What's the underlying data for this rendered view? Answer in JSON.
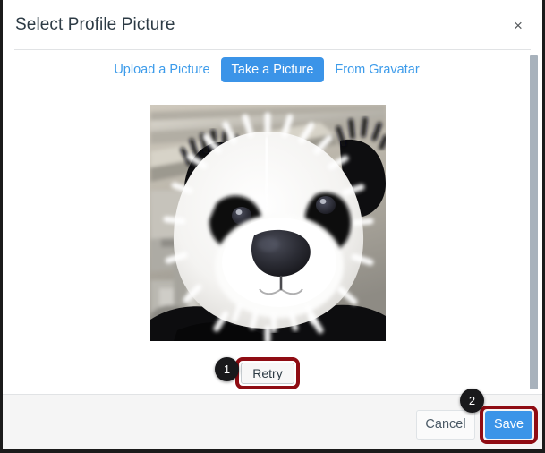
{
  "dialog": {
    "title": "Select Profile Picture",
    "close_icon": "close-icon",
    "close_label": "×"
  },
  "tabs": [
    {
      "label": "Upload a Picture",
      "selected": false
    },
    {
      "label": "Take a Picture",
      "selected": true
    },
    {
      "label": "From Gravatar",
      "selected": false
    }
  ],
  "preview": {
    "alt": "panda-mascot-photo",
    "description": "Close-up photo of a black and white panda mascot costume head indoors"
  },
  "actions": {
    "retry_label": "Retry",
    "cancel_label": "Cancel",
    "save_label": "Save"
  },
  "annotations": {
    "badge_1": "1",
    "badge_2": "2"
  },
  "colors": {
    "accent_blue": "#3b94e8",
    "title_text": "#2d3b45",
    "highlight_red": "#8f0c13",
    "badge_black": "#19191b",
    "footer_bg": "#f5f5f5",
    "scrollbar_thumb": "#a8b2bc"
  }
}
